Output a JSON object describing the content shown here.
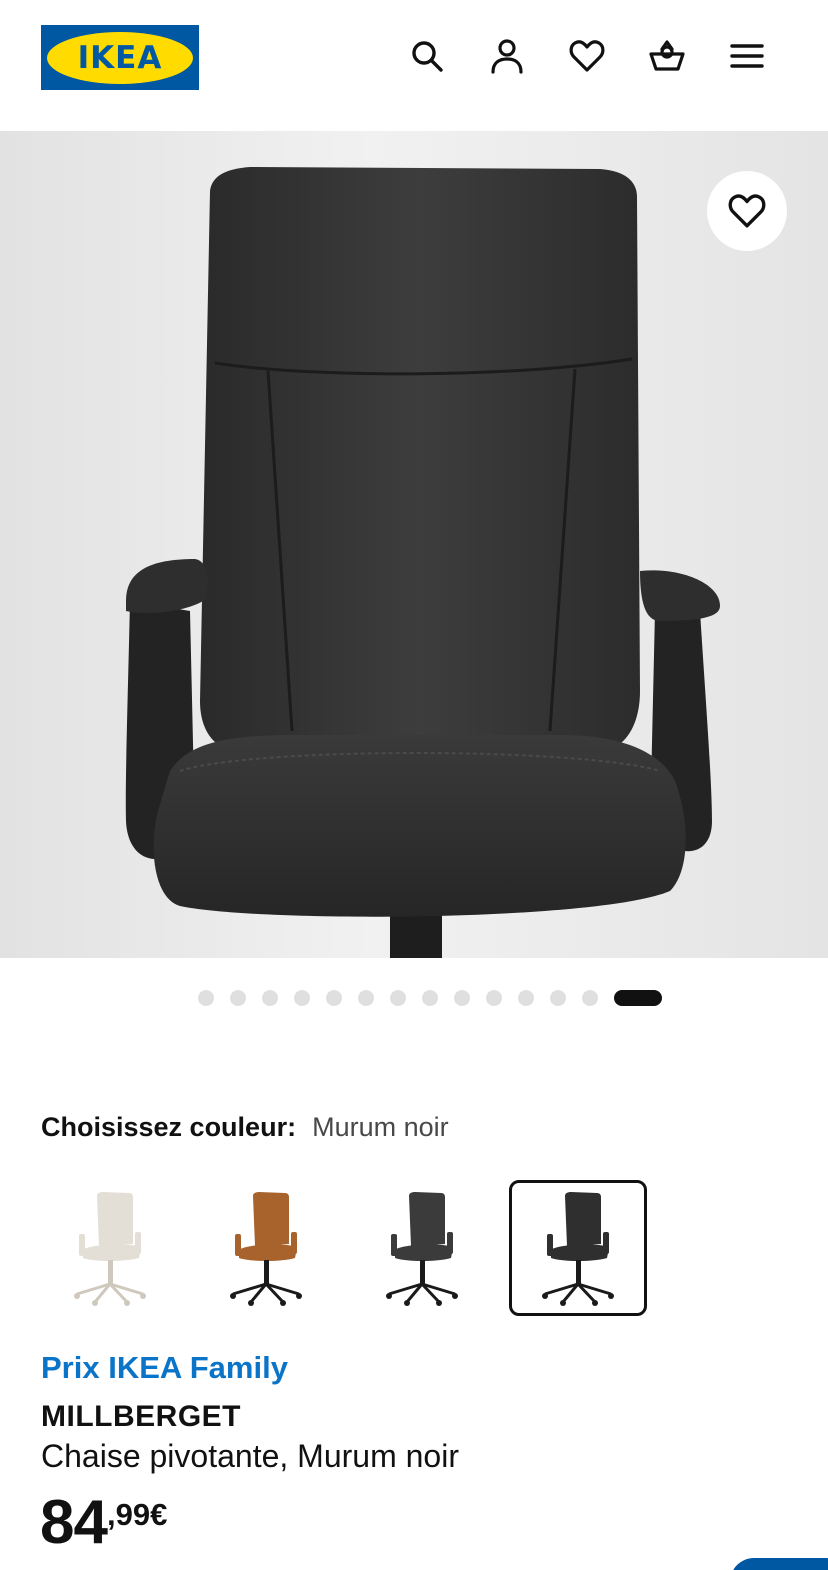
{
  "header": {
    "logo_text": "IKEA",
    "icons": [
      "search-icon",
      "account-icon",
      "heart-icon",
      "cart-icon",
      "menu-icon"
    ]
  },
  "hero": {
    "favourite_icon": "heart-icon",
    "carousel": {
      "total": 14,
      "active_index": 13
    }
  },
  "colour": {
    "label": "Choisissez couleur:",
    "value": "Murum noir",
    "swatches": [
      {
        "color": "#e4dfd6",
        "selected": false
      },
      {
        "color": "#a8622c",
        "selected": false
      },
      {
        "color": "#3b3b3b",
        "selected": false
      },
      {
        "color": "#2f2f2f",
        "selected": true
      }
    ]
  },
  "product": {
    "family_label": "Prix IKEA Family",
    "name": "MILLBERGET",
    "description": "Chaise pivotante, Murum noir",
    "price_integer": "84",
    "price_decimal": ",99€"
  },
  "colors": {
    "family_blue": "#0a74c8",
    "ikea_blue": "#0058a3",
    "ikea_yellow": "#ffdb00"
  }
}
